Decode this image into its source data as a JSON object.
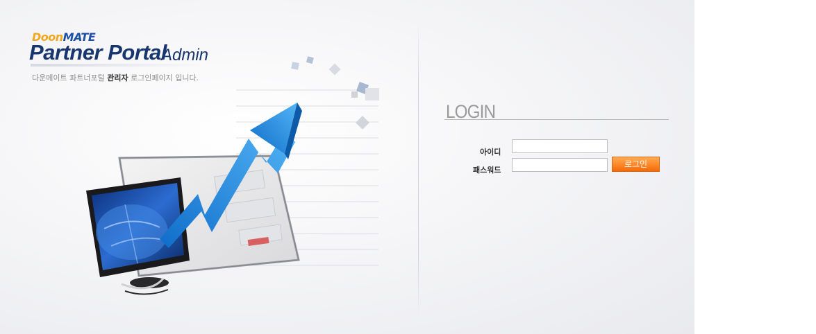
{
  "brand": {
    "logo_prefix": "Doon",
    "logo_suffix": "MATE",
    "title": "Partner Portal",
    "title_suffix": "Admin",
    "subtitle_pre": "다운메이트 파트너포털 ",
    "subtitle_strong": "관리자",
    "subtitle_post": " 로그인페이지 입니다."
  },
  "login": {
    "heading": "LOGIN",
    "id_label": "아이디",
    "password_label": "패스워드",
    "id_value": "",
    "password_value": "",
    "submit_label": "로그인"
  },
  "colors": {
    "brand_navy": "#17356f",
    "brand_orange": "#f0a81e",
    "button_orange": "#ff8a2a",
    "arrow_blue": "#2a8be0"
  }
}
